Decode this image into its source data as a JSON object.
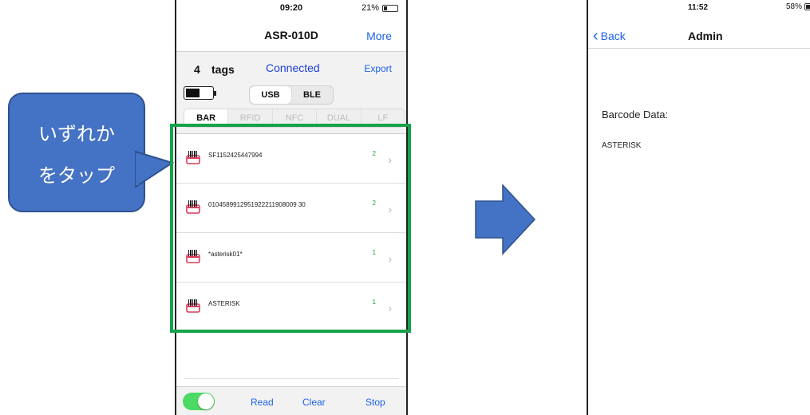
{
  "callout": {
    "line1": "いずれか",
    "line2": "をタップ"
  },
  "phone1": {
    "status": {
      "time": "09:20",
      "battery": "21%"
    },
    "nav": {
      "title": "ASR-010D",
      "more": "More"
    },
    "summary": {
      "count": "4",
      "tags_word": "tags",
      "status": "Connected",
      "export": "Export"
    },
    "connection": {
      "options": [
        "USB",
        "BLE"
      ],
      "selected": "USB"
    },
    "modes": {
      "options": [
        "BAR",
        "RFID",
        "NFC",
        "DUAL",
        "LF"
      ],
      "selected": "BAR"
    },
    "rows": [
      {
        "text": "SF1152425447994",
        "count": "2"
      },
      {
        "text": "0104589912951922211908009 30",
        "count": "2"
      },
      {
        "text": "*asterisk01*",
        "count": "1"
      },
      {
        "text": "ASTERISK",
        "count": "1"
      }
    ],
    "bottom": {
      "read": "Read",
      "clear": "Clear",
      "stop": "Stop",
      "toggle_on": true
    }
  },
  "phone2": {
    "status": {
      "time": "11:52",
      "battery": "58%"
    },
    "nav": {
      "back": "Back",
      "title": "Admin"
    },
    "barcode_label": "Barcode Data:",
    "barcode_value": "ASTERISK"
  },
  "colors": {
    "callout": "#4472C4",
    "highlight": "#16A34A",
    "accent": "#1E63E9",
    "toggle": "#4CD964",
    "arrow": "#4472C4"
  }
}
